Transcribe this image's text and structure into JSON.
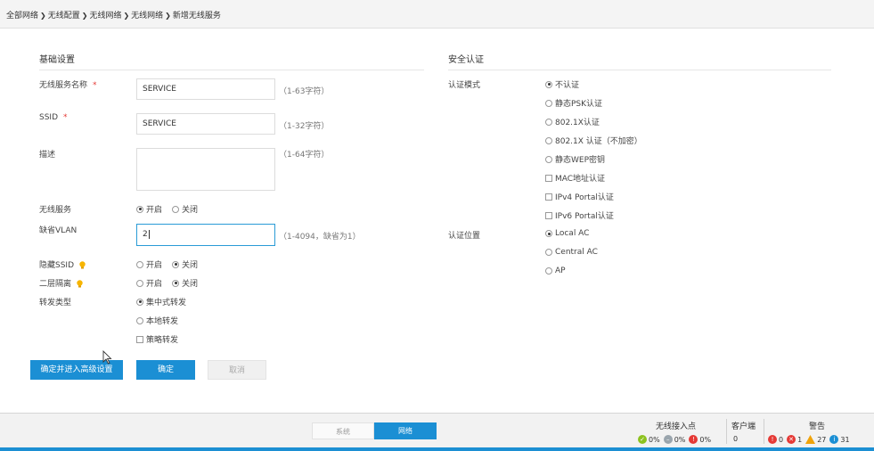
{
  "breadcrumb": [
    "全部网络",
    "无线配置",
    "无线网络",
    "无线网络",
    "新增无线服务"
  ],
  "basic": {
    "title": "基础设置",
    "service_name": {
      "label": "无线服务名称",
      "required": "*",
      "value": "SERVICE",
      "hint": "（1-63字符）"
    },
    "ssid": {
      "label": "SSID",
      "required": "*",
      "value": "SERVICE",
      "hint": "（1-32字符）"
    },
    "desc": {
      "label": "描述",
      "value": "",
      "hint": "（1-64字符）"
    },
    "wireless_service": {
      "label": "无线服务",
      "on": "开启",
      "off": "关闭"
    },
    "vlan": {
      "label": "缺省VLAN",
      "value": "2",
      "hint": "（1-4094，缺省为1）"
    },
    "hide_ssid": {
      "label": "隐藏SSID",
      "on": "开启",
      "off": "关闭"
    },
    "l2_isolation": {
      "label": "二层隔离",
      "on": "开启",
      "off": "关闭"
    },
    "forward": {
      "label": "转发类型",
      "central": "集中式转发",
      "local": "本地转发",
      "policy": "策略转发"
    }
  },
  "security": {
    "title": "安全认证",
    "auth_mode": {
      "label": "认证模式",
      "options": [
        "不认证",
        "静态PSK认证",
        "802.1X认证",
        "802.1X 认证（不加密）",
        "静态WEP密钥"
      ],
      "checks": [
        "MAC地址认证",
        "IPv4 Portal认证",
        "IPv6 Portal认证"
      ]
    },
    "auth_location": {
      "label": "认证位置",
      "options": [
        "Local AC",
        "Central AC",
        "AP"
      ]
    }
  },
  "buttons": {
    "advanced": "确定并进入高级设置",
    "ok": "确定",
    "cancel": "取消"
  },
  "footer": {
    "tabs": {
      "system": "系统",
      "network": "网络"
    },
    "ap": {
      "title": "无线接入点",
      "online": "0%",
      "offline": "0%",
      "fault": "0%"
    },
    "client": {
      "title": "客户端",
      "count": "0"
    },
    "alarm": {
      "title": "警告",
      "critical": "0",
      "major": "1",
      "minor": "27",
      "info": "31"
    }
  },
  "colors": {
    "accent": "#1b8fd4",
    "required": "#e53935",
    "bulb": "#f7b500",
    "ok": "#8dc21f",
    "gray": "#9aa5ad",
    "error": "#e53935",
    "warn": "#f0a30a",
    "info": "#1b8fd4"
  }
}
